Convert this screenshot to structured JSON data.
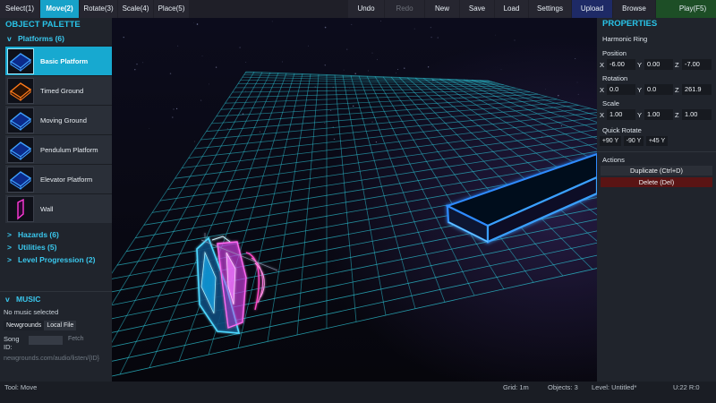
{
  "toolbar": {
    "tools": [
      {
        "label": "Select(1)",
        "active": false
      },
      {
        "label": "Move(2)",
        "active": true
      },
      {
        "label": "Rotate(3)",
        "active": false
      },
      {
        "label": "Scale(4)",
        "active": false
      },
      {
        "label": "Place(5)",
        "active": false
      }
    ],
    "undo": "Undo",
    "redo": "Redo",
    "new": "New",
    "save": "Save",
    "load": "Load",
    "settings": "Settings",
    "upload": "Upload",
    "browse": "Browse",
    "play": "Play(F5)"
  },
  "palette": {
    "title": "OBJECT PALETTE",
    "platforms_category": "Platforms (6)",
    "platforms_chevron": "v",
    "items": [
      {
        "label": "Basic Platform",
        "icon": "blue-cube-icon",
        "selected": true
      },
      {
        "label": "Timed Ground",
        "icon": "orange-cube-icon",
        "selected": false
      },
      {
        "label": "Moving Ground",
        "icon": "blue-cube-icon",
        "selected": false
      },
      {
        "label": "Pendulum Platform",
        "icon": "blue-cube-icon",
        "selected": false
      },
      {
        "label": "Elevator Platform",
        "icon": "blue-cube-icon",
        "selected": false
      },
      {
        "label": "Wall",
        "icon": "magenta-wall-icon",
        "selected": false
      }
    ],
    "collapsed_categories": [
      {
        "chevron": ">",
        "label": "Hazards (6)"
      },
      {
        "chevron": ">",
        "label": "Utilities (5)"
      },
      {
        "chevron": ">",
        "label": "Level Progression (2)"
      }
    ]
  },
  "music": {
    "chevron": "v",
    "title": "MUSIC",
    "status": "No music selected",
    "newgrounds_btn": "Newgrounds",
    "local_file_btn": "Local File",
    "song_id_label": "Song ID:",
    "song_id_value": "",
    "fetch_btn": "Fetch",
    "url_hint": "newgrounds.com/audio/listen/{ID}"
  },
  "properties": {
    "title": "PROPERTIES",
    "object_name": "Harmonic Ring",
    "position_label": "Position",
    "position": {
      "x": "-6.00",
      "y": "0.00",
      "z": "-7.00"
    },
    "rotation_label": "Rotation",
    "rotation": {
      "x": "0.0",
      "y": "0.0",
      "z": "261.9"
    },
    "scale_label": "Scale",
    "scale": {
      "x": "1.00",
      "y": "1.00",
      "z": "1.00"
    },
    "axis_x": "X",
    "axis_y": "Y",
    "axis_z": "Z",
    "quick_rotate_label": "Quick Rotate",
    "quick_rotate": [
      "+90 Y",
      "-90 Y",
      "+45 Y"
    ],
    "actions_label": "Actions",
    "duplicate": "Duplicate (Ctrl+D)",
    "delete": "Delete (Del)"
  },
  "status": {
    "tool": "Tool: Move",
    "grid": "Grid: 1m",
    "objects": "Objects: 3",
    "level": "Level: Untitled*",
    "coords": "U:22 R:0"
  },
  "colors": {
    "accent": "#17a2c9",
    "grid": "#2ec8d8",
    "platform_neon": "#1e6bff",
    "delete_bg": "#5a1414",
    "duplicate_bg": "#2b2f37"
  }
}
